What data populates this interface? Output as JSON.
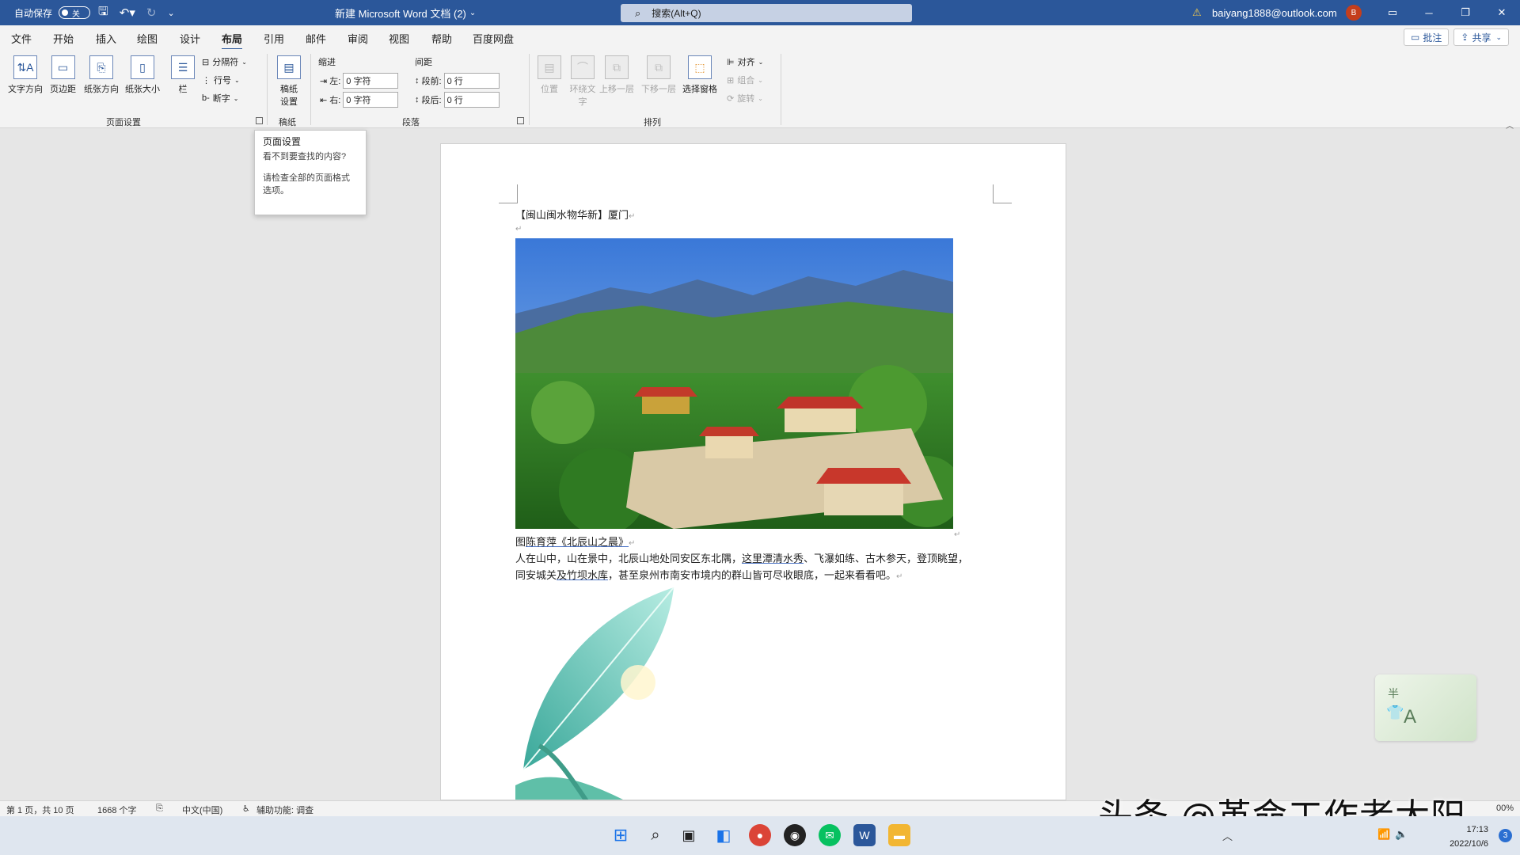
{
  "titlebar": {
    "autosave_label": "自动保存",
    "autosave_state": "关",
    "doc_title": "新建 Microsoft Word 文档 (2)",
    "search_placeholder": "搜索(Alt+Q)",
    "account_email": "baiyang1888@outlook.com",
    "avatar_initial": "B"
  },
  "menu": {
    "tabs": [
      "文件",
      "开始",
      "插入",
      "绘图",
      "设计",
      "布局",
      "引用",
      "邮件",
      "审阅",
      "视图",
      "帮助",
      "百度网盘"
    ],
    "active_tab": "布局",
    "comment_button": "批注",
    "share_button": "共享"
  },
  "ribbon": {
    "page_setup": {
      "text_direction": "文字方向",
      "margins": "页边距",
      "orientation": "纸张方向",
      "size": "纸张大小",
      "columns": "栏",
      "breaks": "分隔符",
      "line_numbers": "行号",
      "hyphenation": "断字",
      "group_label": "页面设置"
    },
    "manuscript": {
      "button": "稿纸\n设置",
      "group_label": "稿纸"
    },
    "paragraph": {
      "indent_header": "缩进",
      "spacing_header": "间距",
      "indent_left_label": "左:",
      "indent_left_value": "0 字符",
      "indent_right_label": "右:",
      "indent_right_value": "0 字符",
      "space_before_label": "段前:",
      "space_before_value": "0 行",
      "space_after_label": "段后:",
      "space_after_value": "0 行",
      "group_label": "段落"
    },
    "arrange": {
      "position": "位置",
      "wrap_text": "环绕文字",
      "bring_forward": "上移一层",
      "send_backward": "下移一层",
      "selection_pane": "选择窗格",
      "align": "对齐",
      "group": "组合",
      "rotate": "旋转",
      "group_label": "排列"
    }
  },
  "tooltip": {
    "title": "页面设置",
    "line1": "看不到要查找的内容?",
    "line2": "请检查全部的页面格式选项。"
  },
  "document": {
    "heading": "【闽山闽水物华新】厦门",
    "caption_prefix": "图",
    "caption_link": "陈育萍《北辰山之晨》",
    "para_line1_a": "人在山中，山在景中，北辰山地处同安区东北隅，",
    "para_line1_link": "这里潭清水秀",
    "para_line1_b": "、飞瀑如练、古木参天，登顶眺望，",
    "para_line2_a": "同安城关",
    "para_line2_link": "及竹坝水库",
    "para_line2_b": "，甚至泉州市南安市境内的群山皆可尽收眼底，一起来看看吧。"
  },
  "statusbar": {
    "page_info": "第 1 页，共 10 页",
    "word_count": "1668 个字",
    "language": "中文(中国)",
    "accessibility": "辅助功能: 调查",
    "zoom": "00%"
  },
  "watermark": "头条 @革命工作者太阳",
  "taskbar": {
    "time": "17:13",
    "date": "2022/10/6",
    "notifications": "3"
  },
  "colors": {
    "word_blue": "#2b579a",
    "ribbon_bg": "#f3f3f3",
    "canvas_bg": "#e6e6e6"
  }
}
